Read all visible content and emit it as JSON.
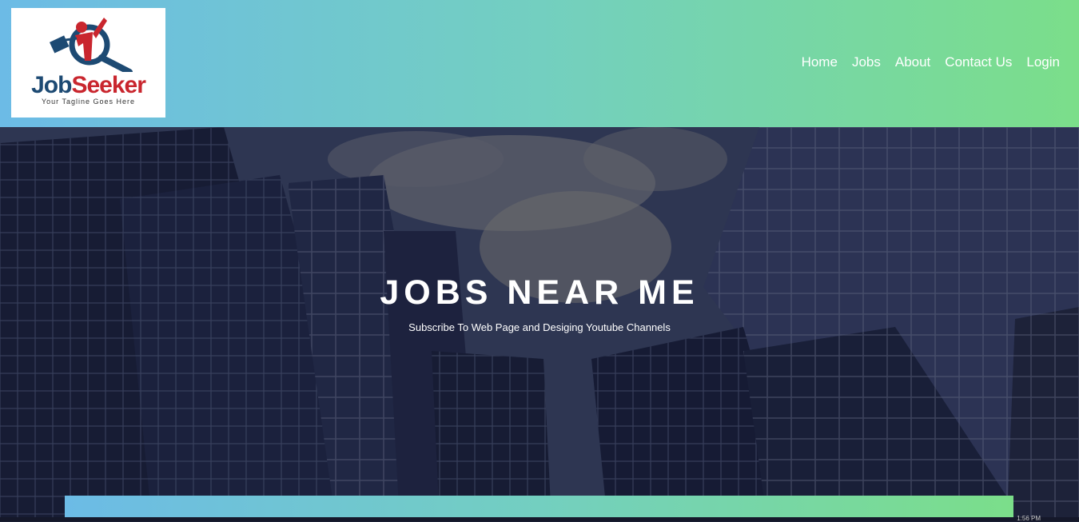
{
  "brand": {
    "name_part1": "Job",
    "name_part2": "Seeker",
    "tagline": "Your Tagline Goes Here"
  },
  "nav": {
    "items": [
      {
        "label": "Home"
      },
      {
        "label": "Jobs"
      },
      {
        "label": "About"
      },
      {
        "label": "Contact Us"
      },
      {
        "label": "Login"
      }
    ]
  },
  "hero": {
    "title": "JOBS NEAR ME",
    "subtitle": "Subscribe To Web Page and Desiging Youtube Channels"
  },
  "taskbar": {
    "clock": "1:56 PM"
  },
  "colors": {
    "gradient_start": "#6cbbe6",
    "gradient_end": "#7bde8a",
    "brand_blue": "#1d4a73",
    "brand_red": "#c9262e"
  }
}
